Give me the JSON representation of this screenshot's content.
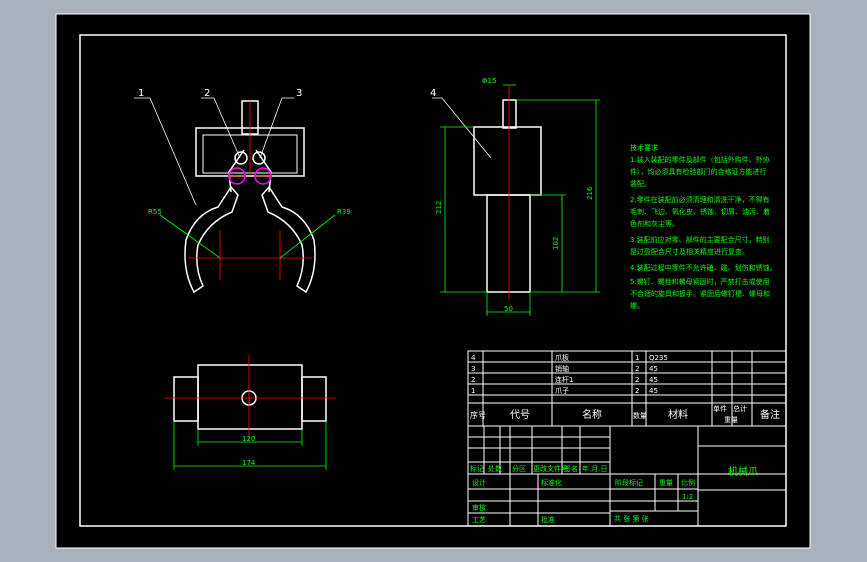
{
  "part_labels": [
    "1",
    "2",
    "3",
    "4"
  ],
  "dimensions": {
    "r55": "R55",
    "r39": "R39",
    "phi15": "Φ15",
    "d212": "212",
    "d108": "108",
    "d102": "102",
    "d216": "216",
    "d50": "50",
    "d120": "120",
    "d174": "174"
  },
  "tech_requirements": {
    "title": "技术要求",
    "lines": [
      "1.装入装配的零件及部件（包括外购件、外协",
      "件），均必须具有检验部门的合格证方能进行",
      "装配。",
      "2.零件在装配前必须清理和清洗干净，不得有",
      "毛刺、飞边、氧化皮、锈蚀、切屑、油污、着",
      "色剂和灰尘等。",
      "3.装配前应对零、部件的主要配合尺寸，特别",
      "是过盈配合尺寸及相关精度进行复查。",
      "4.装配过程中零件不允许磕、碰、划伤和锈蚀。",
      "5.螺钉、螺栓和螺母紧固时，严禁打击或使用",
      "不合适的旋具和扳手。紧固后螺钉槽、螺母和",
      "螺。"
    ]
  },
  "bom": {
    "rows": [
      {
        "seq": "4",
        "code": "",
        "name": "爪板",
        "qty": "1",
        "material": "Q235"
      },
      {
        "seq": "3",
        "code": "",
        "name": "销轴",
        "qty": "2",
        "material": "45"
      },
      {
        "seq": "2",
        "code": "",
        "name": "连杆1",
        "qty": "2",
        "material": "45"
      },
      {
        "seq": "1",
        "code": "",
        "name": "爪子",
        "qty": "2",
        "material": "45"
      }
    ],
    "header": {
      "seq": "序号",
      "code": "代号",
      "name": "名称",
      "qty": "数量",
      "material": "材料",
      "unit_weight": "单件",
      "total_weight": "总计",
      "weight": "重量",
      "remark": "备注"
    }
  },
  "title_block": {
    "drawing_title": "机械爪",
    "sign_row": [
      "标记",
      "处数",
      "分区",
      "更改文件号",
      "签名",
      "年.月.日"
    ],
    "design": "设计",
    "standard": "标准化",
    "check": "审核",
    "process": "工艺",
    "approve": "批准",
    "stage": "阶段标记",
    "weight": "重量",
    "scale_label": "比例",
    "scale": "1:2",
    "sheets": "共    张    第    张"
  },
  "colors": {
    "background": "#000000",
    "frame": "#ffffff",
    "centerline": "#ff0000",
    "dimension": "#00ff00",
    "hidden": "#ff00ff",
    "outer": "#a9b1bc"
  }
}
